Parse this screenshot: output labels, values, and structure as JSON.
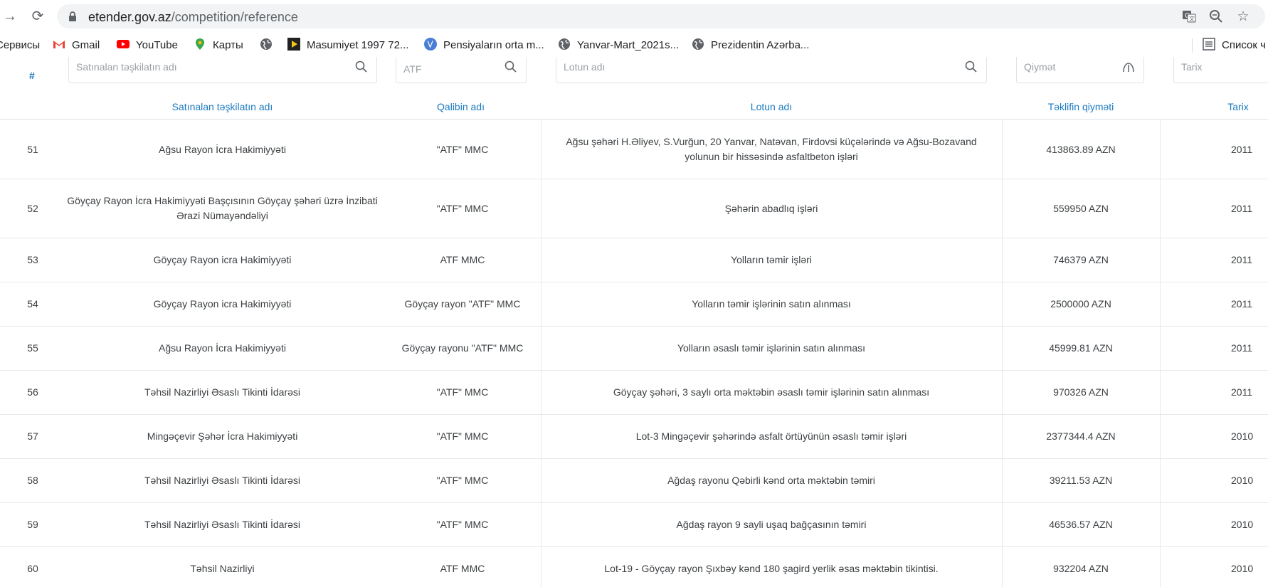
{
  "browser": {
    "url_host": "etender.gov.az",
    "url_path": "/competition/reference",
    "bookmarks": [
      {
        "label": "Сервисы",
        "icon": "apps-icon"
      },
      {
        "label": "Gmail",
        "icon": "gmail-icon"
      },
      {
        "label": "YouTube",
        "icon": "youtube-icon"
      },
      {
        "label": "Карты",
        "icon": "maps-icon"
      },
      {
        "label": "",
        "icon": "globe-icon"
      },
      {
        "label": "Masumiyet 1997 72...",
        "icon": "video-icon"
      },
      {
        "label": "Pensiyaların orta m...",
        "icon": "v-icon"
      },
      {
        "label": "Yanvar-Mart_2021s...",
        "icon": "globe-icon"
      },
      {
        "label": "Prezidentin Azərba...",
        "icon": "globe-icon"
      },
      {
        "label": "Список ч",
        "icon": "reading-list-icon"
      }
    ]
  },
  "filters": {
    "hash": "#",
    "org_placeholder": "Satınalan təşkilatın adı",
    "template_placeholder": "ATF",
    "lot_placeholder": "Lotun adı",
    "price_placeholder": "Qiymət",
    "date_placeholder": "Tarix"
  },
  "table": {
    "headers": {
      "org": "Satınalan təşkilatın adı",
      "template": "Qalibin adı",
      "lot": "Lotun adı",
      "price": "Təklifin qiyməti",
      "date": "Tarix"
    },
    "rows": [
      {
        "num": "51",
        "org": "Ağsu Rayon İcra Hakimiyyəti",
        "template": "\"ATF\" MMC",
        "lot": "Ağsu şəhəri H.Əliyev, S.Vurğun, 20 Yanvar, Natəvan, Firdovsi küçələrində və Ağsu-Bozavand yolunun bir hissəsində asfaltbeton işləri",
        "price": "413863.89 AZN",
        "date": "2011"
      },
      {
        "num": "52",
        "org": "Göyçay Rayon İcra Hakimiyyəti Başçısının Göyçay şəhəri üzrə İnzibati Ərazi Nümayəndəliyi",
        "template": "\"ATF\" MMC",
        "lot": "Şəhərin abadlıq işləri",
        "price": "559950 AZN",
        "date": "2011"
      },
      {
        "num": "53",
        "org": "Göyçay Rayon icra Hakimiyyəti",
        "template": "ATF MMC",
        "lot": "Yolların təmir işləri",
        "price": "746379 AZN",
        "date": "2011"
      },
      {
        "num": "54",
        "org": "Göyçay Rayon icra Hakimiyyəti",
        "template": "Göyçay rayon \"ATF\" MMC",
        "lot": "Yolların təmir işlərinin satın alınması",
        "price": "2500000 AZN",
        "date": "2011"
      },
      {
        "num": "55",
        "org": "Ağsu Rayon İcra Hakimiyyəti",
        "template": "Göyçay rayonu \"ATF\" MMC",
        "lot": "Yolların əsaslı təmir işlərinin satın alınması",
        "price": "45999.81 AZN",
        "date": "2011"
      },
      {
        "num": "56",
        "org": "Təhsil Nazirliyi Əsaslı Tikinti İdarəsi",
        "template": "\"ATF\" MMC",
        "lot": "Göyçay şəhəri, 3 saylı orta məktəbin əsaslı təmir işlərinin satın alınması",
        "price": "970326 AZN",
        "date": "2011"
      },
      {
        "num": "57",
        "org": "Mingəçevir Şəhər İcra Hakimiyyəti",
        "template": "\"ATF\" MMC",
        "lot": "Lot-3 Mingəçevir şəhərində asfalt örtüyünün əsaslı təmir işləri",
        "price": "2377344.4 AZN",
        "date": "2010"
      },
      {
        "num": "58",
        "org": "Təhsil Nazirliyi Əsaslı Tikinti İdarəsi",
        "template": "\"ATF\" MMC",
        "lot": "Ağdaş rayonu Qəbirli kənd orta məktəbin təmiri",
        "price": "39211.53 AZN",
        "date": "2010"
      },
      {
        "num": "59",
        "org": "Təhsil Nazirliyi Əsaslı Tikinti İdarəsi",
        "template": "\"ATF\" MMC",
        "lot": "Ağdaş rayon 9 sayli uşaq bağçasının təmiri",
        "price": "46536.57 AZN",
        "date": "2010"
      },
      {
        "num": "60",
        "org": "Təhsil Nazirliyi",
        "template": "ATF MMC",
        "lot": "Lot-19 - Göyçay rayon Şıxbəy kənd 180 şagird yerlik əsas məktəbin tikintisi.",
        "price": "932204 AZN",
        "date": "2010"
      }
    ]
  }
}
